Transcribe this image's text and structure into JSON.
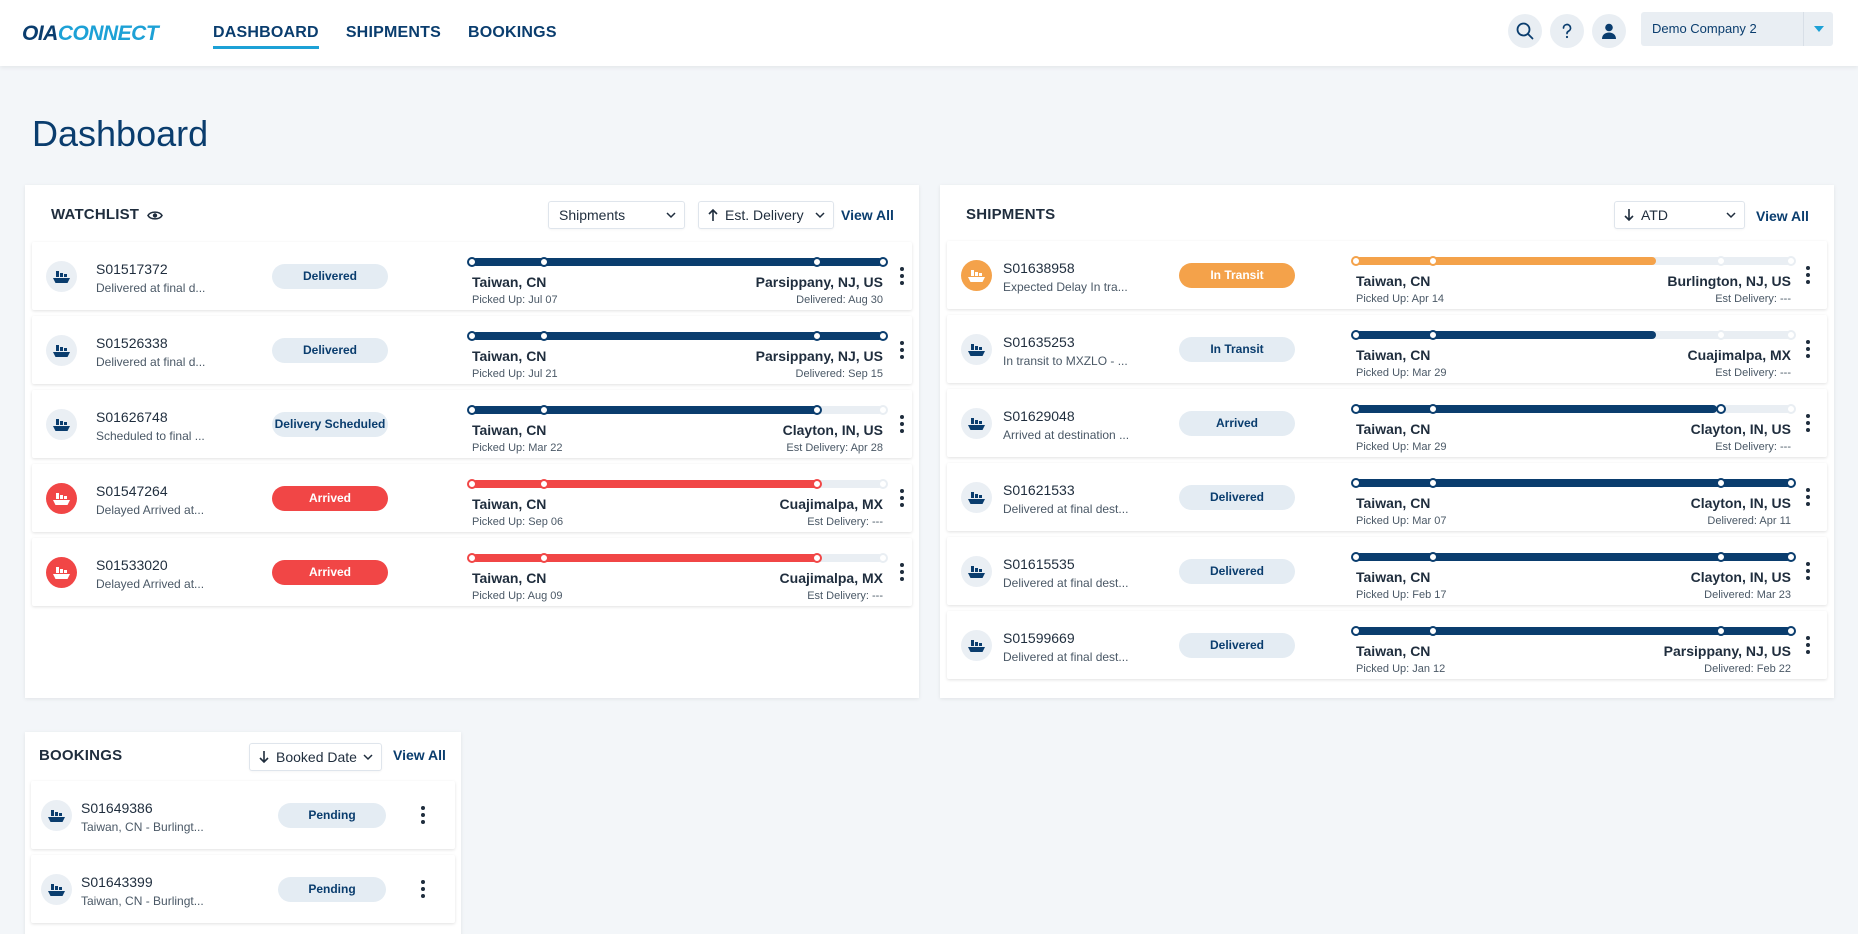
{
  "brand": {
    "part1": "OIA",
    "part2": "CONNECT"
  },
  "nav": [
    {
      "label": "DASHBOARD",
      "active": true
    },
    {
      "label": "SHIPMENTS",
      "active": false
    },
    {
      "label": "BOOKINGS",
      "active": false
    }
  ],
  "header_icons": [
    "search-icon",
    "help-icon",
    "user-icon"
  ],
  "company_select": {
    "value": "Demo Company 2"
  },
  "page_title": "Dashboard",
  "colors": {
    "navy": "#0a3d6e",
    "accent": "#1da1d6",
    "red": "#f14646",
    "orange": "#f4a24a",
    "light": "#e4ecf3"
  },
  "watchlist": {
    "title": "WATCHLIST",
    "type_select": "Shipments",
    "sort_select": "Est. Delivery",
    "sort_direction": "up",
    "view_all": "View All",
    "rows": [
      {
        "id": "S01517372",
        "desc": "Delivered at final d...",
        "status": "Delivered",
        "status_style": "normal",
        "origin": "Taiwan, CN",
        "dest": "Parsippany, NJ, US",
        "picked": "Picked Up: Jul 07",
        "delivery": "Delivered: Aug 30",
        "progress": 1.0,
        "milestones_done": 4
      },
      {
        "id": "S01526338",
        "desc": "Delivered at final d...",
        "status": "Delivered",
        "status_style": "normal",
        "origin": "Taiwan, CN",
        "dest": "Parsippany, NJ, US",
        "picked": "Picked Up: Jul 21",
        "delivery": "Delivered: Sep 15",
        "progress": 1.0,
        "milestones_done": 4
      },
      {
        "id": "S01626748",
        "desc": "Scheduled to final ...",
        "status": "Delivery Scheduled",
        "status_style": "normal",
        "origin": "Taiwan, CN",
        "dest": "Clayton, IN, US",
        "picked": "Picked Up: Mar 22",
        "delivery": "Est Delivery: Apr 28",
        "progress": 0.85,
        "milestones_done": 3
      },
      {
        "id": "S01547264",
        "desc": "Delayed Arrived at...",
        "status": "Arrived",
        "status_style": "red",
        "origin": "Taiwan, CN",
        "dest": "Cuajimalpa, MX",
        "picked": "Picked Up: Sep 06",
        "delivery": "Est Delivery: ---",
        "progress": 0.85,
        "milestones_done": 3
      },
      {
        "id": "S01533020",
        "desc": "Delayed Arrived at...",
        "status": "Arrived",
        "status_style": "red",
        "origin": "Taiwan, CN",
        "dest": "Cuajimalpa, MX",
        "picked": "Picked Up: Aug 09",
        "delivery": "Est Delivery: ---",
        "progress": 0.85,
        "milestones_done": 3
      }
    ]
  },
  "shipments": {
    "title": "SHIPMENTS",
    "sort_select": "ATD",
    "sort_direction": "down",
    "view_all": "View All",
    "rows": [
      {
        "id": "S01638958",
        "desc": "Expected Delay In tra...",
        "status": "In Transit",
        "status_style": "orange",
        "origin": "Taiwan, CN",
        "dest": "Burlington, NJ, US",
        "picked": "Picked Up: Apr 14",
        "delivery": "Est Delivery: ---",
        "progress": 0.69,
        "milestones_done": 2
      },
      {
        "id": "S01635253",
        "desc": "In transit to MXZLO - ...",
        "status": "In Transit",
        "status_style": "normal",
        "origin": "Taiwan, CN",
        "dest": "Cuajimalpa, MX",
        "picked": "Picked Up: Mar 29",
        "delivery": "Est Delivery: ---",
        "progress": 0.69,
        "milestones_done": 2
      },
      {
        "id": "S01629048",
        "desc": "Arrived at destination ...",
        "status": "Arrived",
        "status_style": "normal",
        "origin": "Taiwan, CN",
        "dest": "Clayton, IN, US",
        "picked": "Picked Up: Mar 29",
        "delivery": "Est Delivery: ---",
        "progress": 0.83,
        "milestones_done": 3
      },
      {
        "id": "S01621533",
        "desc": "Delivered at final dest...",
        "status": "Delivered",
        "status_style": "normal",
        "origin": "Taiwan, CN",
        "dest": "Clayton, IN, US",
        "picked": "Picked Up: Mar 07",
        "delivery": "Delivered: Apr 11",
        "progress": 1.0,
        "milestones_done": 4
      },
      {
        "id": "S01615535",
        "desc": "Delivered at final dest...",
        "status": "Delivered",
        "status_style": "normal",
        "origin": "Taiwan, CN",
        "dest": "Clayton, IN, US",
        "picked": "Picked Up: Feb 17",
        "delivery": "Delivered: Mar 23",
        "progress": 1.0,
        "milestones_done": 4
      },
      {
        "id": "S01599669",
        "desc": "Delivered at final dest...",
        "status": "Delivered",
        "status_style": "normal",
        "origin": "Taiwan, CN",
        "dest": "Parsippany, NJ, US",
        "picked": "Picked Up: Jan 12",
        "delivery": "Delivered: Feb 22",
        "progress": 1.0,
        "milestones_done": 4
      }
    ]
  },
  "bookings": {
    "title": "BOOKINGS",
    "sort_select": "Booked Date",
    "sort_direction": "down",
    "view_all": "View All",
    "rows": [
      {
        "id": "S01649386",
        "desc": "Taiwan, CN - Burlingt...",
        "status": "Pending"
      },
      {
        "id": "S01643399",
        "desc": "Taiwan, CN - Burlingt...",
        "status": "Pending"
      }
    ]
  }
}
